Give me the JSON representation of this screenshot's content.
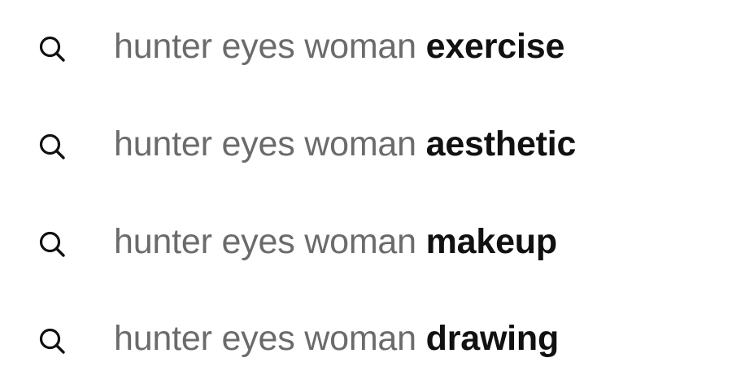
{
  "suggestions": [
    {
      "prefix": "hunter eyes woman",
      "completion": "exercise",
      "icon": "search-icon"
    },
    {
      "prefix": "hunter eyes woman",
      "completion": "aesthetic",
      "icon": "search-icon"
    },
    {
      "prefix": "hunter eyes woman",
      "completion": "makeup",
      "icon": "search-icon"
    },
    {
      "prefix": "hunter eyes woman",
      "completion": "drawing",
      "icon": "search-icon"
    }
  ],
  "colors": {
    "prefix_text": "#6b6b6b",
    "completion_text": "#111111",
    "icon": "#111111",
    "background": "#ffffff"
  }
}
